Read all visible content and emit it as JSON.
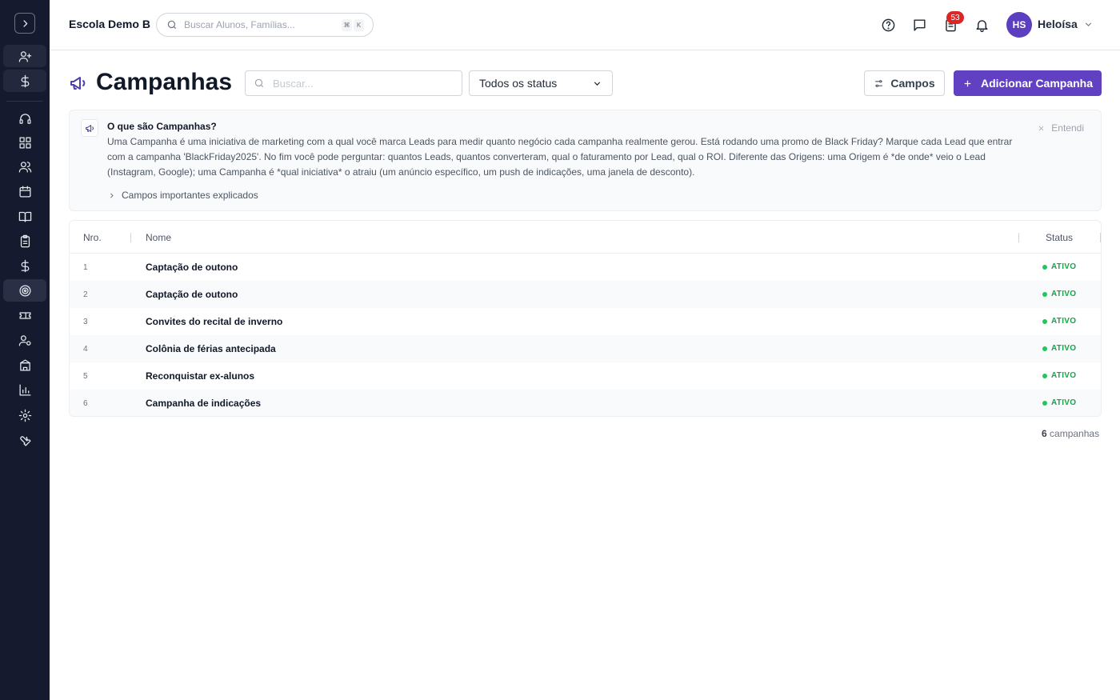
{
  "header": {
    "school_name": "Escola Demo B",
    "search_placeholder": "Buscar Alunos, Famílias...",
    "shortcut_keys": [
      "⌘",
      "K"
    ],
    "notification_count": "53",
    "user_initials": "HS",
    "user_name": "Heloísa"
  },
  "sidebar": {
    "items": [
      {
        "icon": "user-plus-icon"
      },
      {
        "icon": "dollar-icon"
      },
      {
        "icon": "headset-icon"
      },
      {
        "icon": "dashboard-icon"
      },
      {
        "icon": "users-icon"
      },
      {
        "icon": "calendar-icon"
      },
      {
        "icon": "book-icon"
      },
      {
        "icon": "clipboard-icon"
      },
      {
        "icon": "dollar-icon"
      },
      {
        "icon": "target-icon",
        "active": true
      },
      {
        "icon": "ticket-icon"
      },
      {
        "icon": "user-gear-icon"
      },
      {
        "icon": "building-icon"
      },
      {
        "icon": "bar-chart-icon"
      },
      {
        "icon": "gear-icon"
      },
      {
        "icon": "wrench-icon"
      }
    ]
  },
  "page": {
    "title": "Campanhas",
    "search_placeholder": "Buscar...",
    "status_filter": "Todos os status",
    "fields_button": "Campos",
    "add_button": "Adicionar Campanha"
  },
  "info": {
    "title": "O que são Campanhas?",
    "body": "Uma Campanha é uma iniciativa de marketing com a qual você marca Leads para medir quanto negócio cada campanha realmente gerou. Está rodando uma promo de Black Friday? Marque cada Lead que entrar com a campanha 'BlackFriday2025'. No fim você pode perguntar: quantos Leads, quantos converteram, qual o faturamento por Lead, qual o ROI. Diferente das Origens: uma Origem é *de onde* veio o Lead (Instagram, Google); uma Campanha é *qual iniciativa* o atraiu (um anúncio específico, um push de indicações, uma janela de desconto).",
    "expand_label": "Campos importantes explicados",
    "dismiss_label": "Entendi"
  },
  "table": {
    "columns": {
      "nro": "Nro.",
      "nome": "Nome",
      "status": "Status"
    },
    "rows": [
      {
        "nro": "1",
        "nome": "Captação de outono",
        "status": "ATIVO"
      },
      {
        "nro": "2",
        "nome": "Captação de outono",
        "status": "ATIVO"
      },
      {
        "nro": "3",
        "nome": "Convites do recital de inverno",
        "status": "ATIVO"
      },
      {
        "nro": "4",
        "nome": "Colônia de férias antecipada",
        "status": "ATIVO"
      },
      {
        "nro": "5",
        "nome": "Reconquistar ex-alunos",
        "status": "ATIVO"
      },
      {
        "nro": "6",
        "nome": "Campanha de indicações",
        "status": "ATIVO"
      }
    ]
  },
  "footer": {
    "count": "6",
    "count_label": "campanhas"
  },
  "colors": {
    "accent": "#6141c2",
    "sidebar_bg": "#161a2e",
    "status_active": "#16a34a"
  }
}
